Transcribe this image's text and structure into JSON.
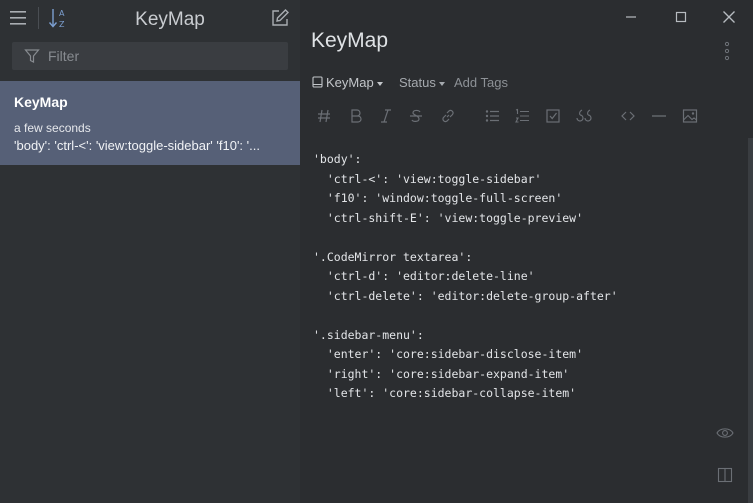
{
  "sidebar": {
    "title": "KeyMap",
    "filter_placeholder": "Filter",
    "notes": [
      {
        "title": "KeyMap",
        "time": "a few seconds",
        "preview": "'body': 'ctrl-<': 'view:toggle-sidebar' 'f10': '..."
      }
    ]
  },
  "editor": {
    "title": "KeyMap",
    "notebook": "KeyMap",
    "status": "Status",
    "add_tags": "Add Tags",
    "code_lines": [
      "'body':",
      "  'ctrl-<': 'view:toggle-sidebar'",
      "  'f10': 'window:toggle-full-screen'",
      "  'ctrl-shift-E': 'view:toggle-preview'",
      "",
      "'.CodeMirror textarea':",
      "  'ctrl-d': 'editor:delete-line'",
      "  'ctrl-delete': 'editor:delete-group-after'",
      "",
      "'.sidebar-menu':",
      "  'enter': 'core:sidebar-disclose-item'",
      "  'right': 'core:sidebar-expand-item'",
      "  'left': 'core:sidebar-collapse-item'"
    ]
  },
  "icons": {
    "menu": "hamburger-icon",
    "sort": "sort-az-icon",
    "compose": "compose-icon",
    "filter": "filter-icon",
    "minimize": "minimize-icon",
    "maximize": "maximize-icon",
    "close": "close-icon",
    "more": "kebab-icon",
    "preview": "eye-icon",
    "split": "split-view-icon"
  },
  "colors": {
    "sidebar_bg": "#2e3134",
    "editor_bg": "#2b2d30",
    "selected_note_bg": "#566077"
  }
}
